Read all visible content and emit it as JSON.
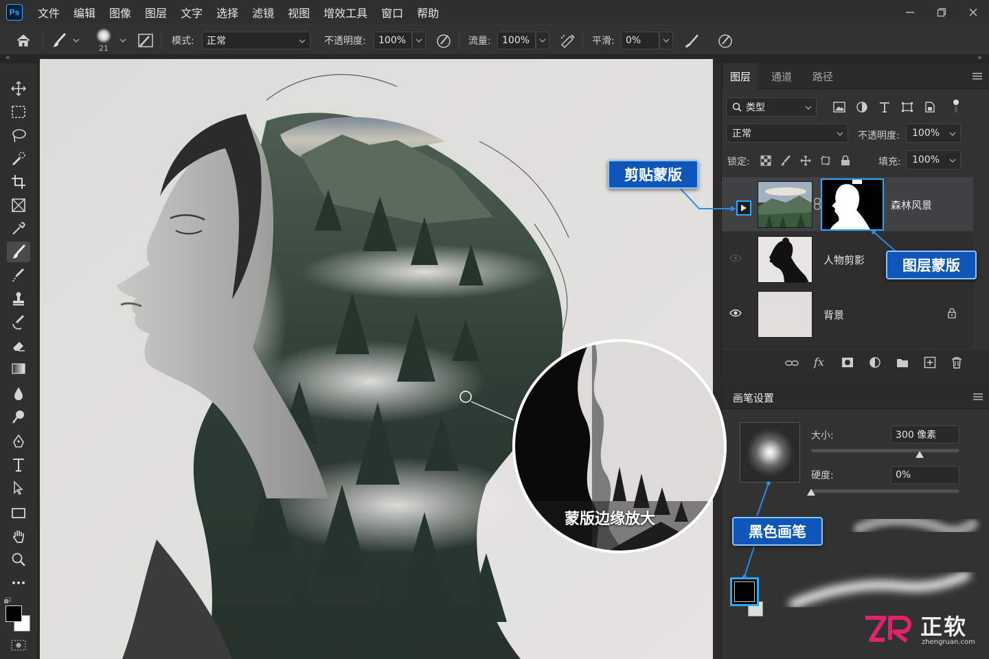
{
  "app": {
    "logo": "Ps"
  },
  "menu": [
    "文件",
    "编辑",
    "图像",
    "图层",
    "文字",
    "选择",
    "滤镜",
    "视图",
    "增效工具",
    "窗口",
    "帮助"
  ],
  "options": {
    "brush_size": "21",
    "mode_label": "模式:",
    "mode_value": "正常",
    "opacity_label": "不透明度:",
    "opacity_value": "100%",
    "flow_label": "流量:",
    "flow_value": "100%",
    "smooth_label": "平滑:",
    "smooth_value": "0%"
  },
  "collapse": {
    "left": "«",
    "right": "»"
  },
  "tools": [
    "move-icon",
    "marquee-icon",
    "lasso-icon",
    "quick-select-icon",
    "crop-icon",
    "frame-icon",
    "eyedropper-icon",
    "brush-icon",
    "healing-icon",
    "stamp-icon",
    "history-brush-icon",
    "eraser-icon",
    "gradient-icon",
    "blur-icon",
    "dodge-icon",
    "pen-icon",
    "type-icon",
    "path-select-icon",
    "rectangle-icon",
    "hand-icon",
    "zoom-icon",
    "more-icon"
  ],
  "colors": {
    "foreground": "#000000",
    "background": "#ffffff",
    "accent": "#31a8ff",
    "callout": "#0e57b8"
  },
  "layers_panel": {
    "tabs": [
      "图层",
      "通道",
      "路径"
    ],
    "filter_label": "类型",
    "blend_mode": "正常",
    "opacity_label": "不透明度:",
    "opacity_value": "100%",
    "lock_label": "锁定:",
    "fill_label": "填充:",
    "fill_value": "100%",
    "layers": [
      {
        "name": "森林风景",
        "visible": true,
        "clipped": true,
        "has_mask": true
      },
      {
        "name": "人物剪影",
        "visible": false
      },
      {
        "name": "背景",
        "visible": true,
        "locked": true
      }
    ],
    "footer_fx": "fx"
  },
  "brush_panel": {
    "title": "画笔设置",
    "size_label": "大小:",
    "size_value": "300 像素",
    "size_fraction": 0.73,
    "hardness_label": "硬度:",
    "hardness_value": "0%",
    "hardness_fraction": 0.0
  },
  "callouts": {
    "clip_mask": "剪贴蒙版",
    "layer_mask": "图层蒙版",
    "magnify": "蒙版边缘放大",
    "black_brush": "黑色画笔"
  },
  "watermark": {
    "brand": "正软",
    "url": "zhengruan.com"
  }
}
